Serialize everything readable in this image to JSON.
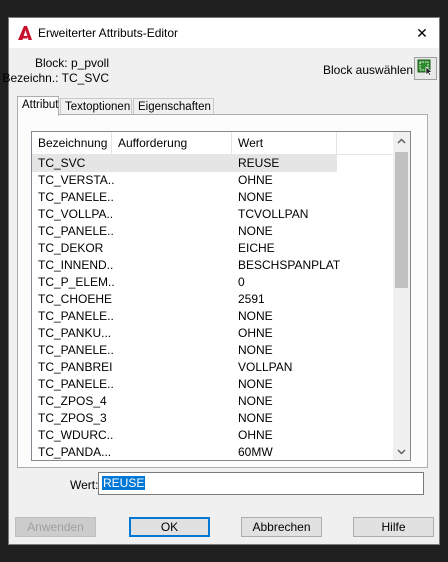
{
  "window": {
    "title": "Erweiterter Attributs-Editor",
    "close_glyph": "✕",
    "app_icon": "autocad-a-icon",
    "icon_color": "#c8102e"
  },
  "info": {
    "block_label": "Block:",
    "block_value": "p_pvoll",
    "tag_label": "Bezeichn.:",
    "tag_value": "TC_SVC"
  },
  "select_block": {
    "label": "Block auswählen",
    "icon": "select-objects-icon"
  },
  "tabs": [
    {
      "label": "Attribut",
      "active": true
    },
    {
      "label": "Textoptionen",
      "active": false
    },
    {
      "label": "Eigenschaften",
      "active": false
    }
  ],
  "grid": {
    "headers": [
      "Bezeichnung",
      "Aufforderung",
      "Wert"
    ],
    "rows": [
      {
        "name": "TC_SVC",
        "prompt": "",
        "value": "REUSE"
      },
      {
        "name": "TC_VERSTA...",
        "prompt": "",
        "value": "OHNE"
      },
      {
        "name": "TC_PANELE...",
        "prompt": "",
        "value": "NONE"
      },
      {
        "name": "TC_VOLLPA...",
        "prompt": "",
        "value": "TCVOLLPAN"
      },
      {
        "name": "TC_PANELE...",
        "prompt": "",
        "value": "NONE"
      },
      {
        "name": "TC_DEKOR",
        "prompt": "",
        "value": "EICHE"
      },
      {
        "name": "TC_INNEND...",
        "prompt": "",
        "value": "BESCHSPANPLAT"
      },
      {
        "name": "TC_P_ELEM...",
        "prompt": "",
        "value": "0"
      },
      {
        "name": "TC_CHOEHE",
        "prompt": "",
        "value": "2591"
      },
      {
        "name": "TC_PANELE...",
        "prompt": "",
        "value": "NONE"
      },
      {
        "name": "TC_PANKU...",
        "prompt": "",
        "value": "OHNE"
      },
      {
        "name": "TC_PANELE...",
        "prompt": "",
        "value": "NONE"
      },
      {
        "name": "TC_PANBREI",
        "prompt": "",
        "value": "VOLLPAN"
      },
      {
        "name": "TC_PANELE...",
        "prompt": "",
        "value": "NONE"
      },
      {
        "name": "TC_ZPOS_4",
        "prompt": "",
        "value": "NONE"
      },
      {
        "name": "TC_ZPOS_3",
        "prompt": "",
        "value": "NONE"
      },
      {
        "name": "TC_WDURC...",
        "prompt": "",
        "value": "OHNE"
      },
      {
        "name": "TC_PANDA...",
        "prompt": "",
        "value": "60MW"
      }
    ]
  },
  "value_field": {
    "label": "Wert:",
    "value": "REUSE"
  },
  "buttons": {
    "apply": "Anwenden",
    "ok": "OK",
    "cancel": "Abbrechen",
    "help": "Hilfe"
  },
  "colors": {
    "selection": "#0078d7",
    "dialog_bg": "#f0f0f0"
  }
}
